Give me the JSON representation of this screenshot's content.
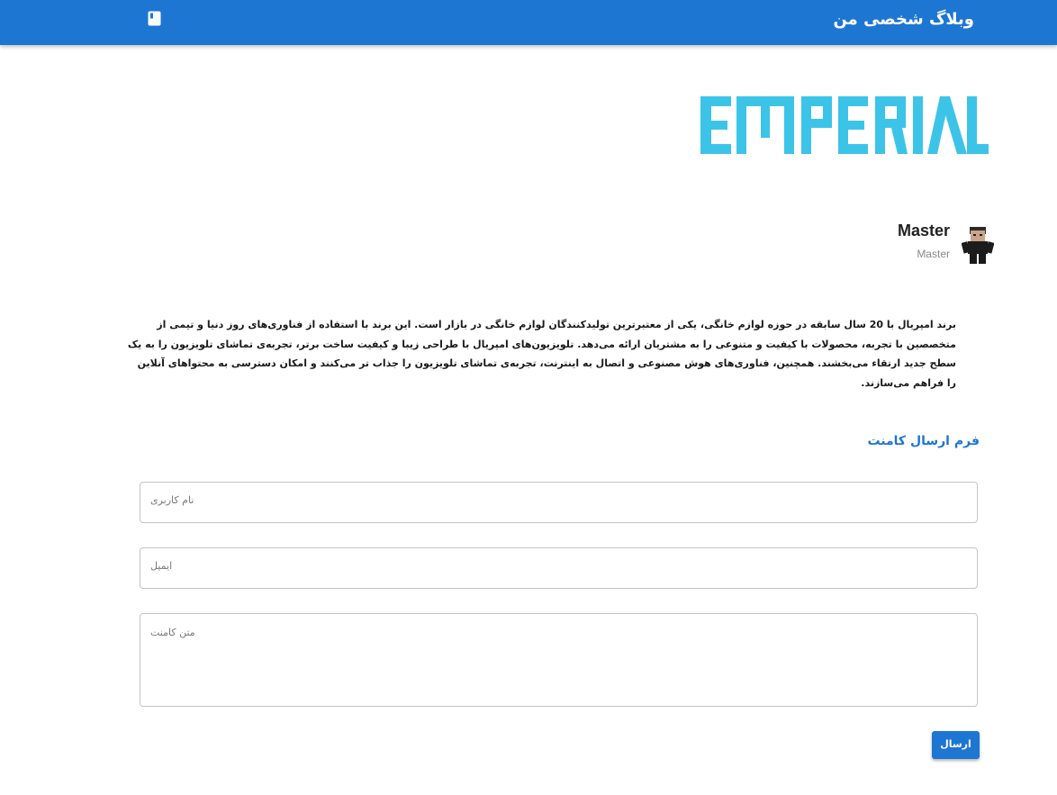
{
  "header": {
    "site_title": "وبلاگ شخصی من",
    "icon": "book-icon",
    "bg_color": "#1d76d2"
  },
  "hero": {
    "logo_text": "EMPERIAL",
    "logo_color": "#3cc4e8"
  },
  "author": {
    "name": "Master",
    "subtitle": "Master",
    "avatar_icon": "avatar-icon"
  },
  "article": {
    "body": "برند امپریال با 20 سال سابقه در حوزه لوازم خانگی، یکی از معتبرترین تولیدکنندگان لوازم خانگی در بازار است. این برند با استفاده از فناوری‌های روز دنیا و تیمی از متخصصین با تجربه، محصولات با کیفیت و متنوعی را به مشتریان ارائه می‌دهد. تلویزیون‌های امپریال با طراحی زیبا و کیفیت ساخت برتر، تجربه‌ی تماشای تلویزیون را به یک سطح جدید ارتقاء می‌بخشند. همچنین، فناوری‌های هوش مصنوعی و اتصال به اینترنت، تجربه‌ی تماشای تلویزیون را جذاب تر می‌کنند و امکان دسترسی به محتواهای آنلاین را فراهم می‌سازند."
  },
  "comment_form": {
    "title": "فرم ارسال کامنت",
    "username_placeholder": "نام کاربری",
    "email_placeholder": "ایمیل",
    "comment_placeholder": "متن کامنت",
    "submit_label": "ارسال",
    "accent_color": "#1d76d2"
  }
}
